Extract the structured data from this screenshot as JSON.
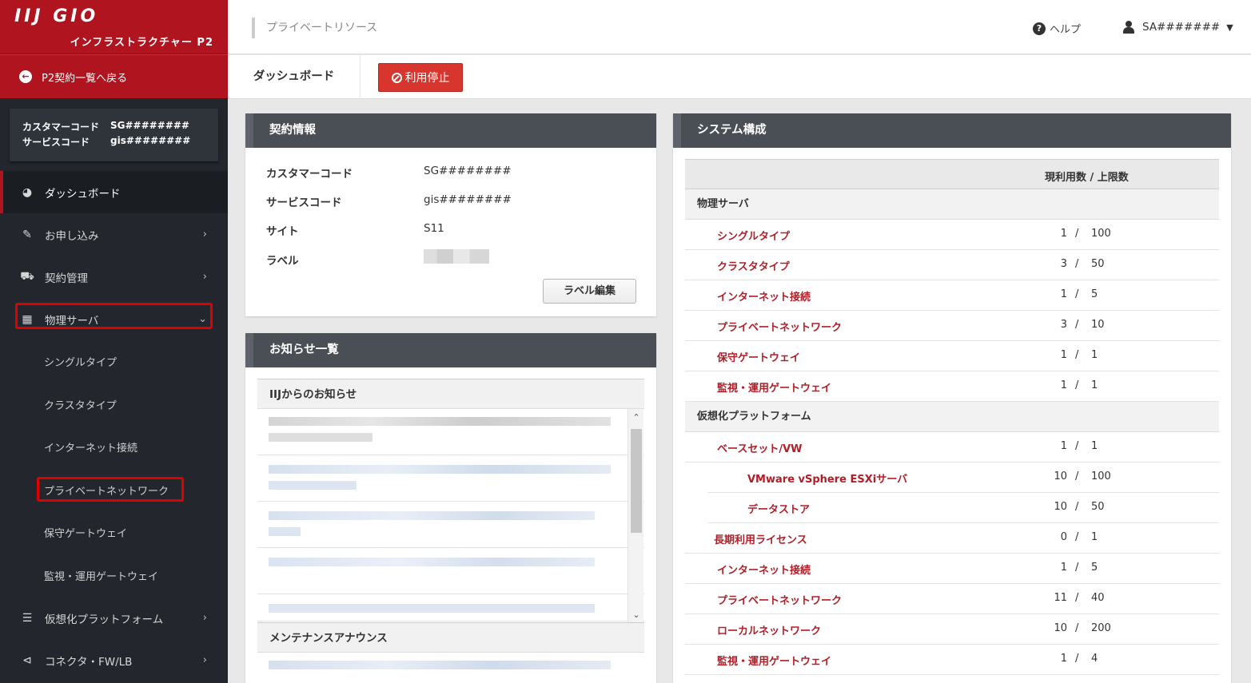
{
  "brand": {
    "logo": "IIJ GIO",
    "product": "インフラストラクチャー P2"
  },
  "sidebar": {
    "back_label": "P2契約一覧へ戻る",
    "codes": [
      {
        "key": "カスタマーコード",
        "value": "SG########"
      },
      {
        "key": "サービスコード",
        "value": "gis########"
      }
    ],
    "items": [
      {
        "label": "ダッシュボード",
        "icon": "dashboard-icon"
      },
      {
        "label": "お申し込み",
        "icon": "edit-icon"
      },
      {
        "label": "契約管理",
        "icon": "truck-icon"
      },
      {
        "label": "物理サーバ",
        "icon": "building-icon"
      },
      {
        "label": "仮想化プラットフォーム",
        "icon": "server-icon"
      },
      {
        "label": "コネクタ・FW/LB",
        "icon": "share-icon"
      }
    ],
    "sub_items": [
      "シングルタイプ",
      "クラスタタイプ",
      "インターネット接続",
      "プライベートネットワーク",
      "保守ゲートウェイ",
      "監視・運用ゲートウェイ"
    ]
  },
  "header": {
    "breadcrumb": "プライベートリソース",
    "help": "ヘルプ",
    "user": "SA#######"
  },
  "subbar": {
    "title": "ダッシュボード",
    "stop_button": "利用停止"
  },
  "contract": {
    "title": "契約情報",
    "rows": [
      {
        "key": "カスタマーコード",
        "value": "SG########"
      },
      {
        "key": "サービスコード",
        "value": "gis########"
      },
      {
        "key": "サイト",
        "value": "S11"
      },
      {
        "key": "ラベル",
        "value": ""
      }
    ],
    "edit_button": "ラベル編集"
  },
  "notices": {
    "title": "お知らせ一覧",
    "group1": "IIJからのお知らせ",
    "group2": "メンテナンスアナウンス"
  },
  "system": {
    "title": "システム構成",
    "header": "現利用数 / 上限数",
    "sections": [
      {
        "name": "物理サーバ",
        "rows": [
          {
            "name": "シングルタイプ",
            "cur": "1",
            "max": "100"
          },
          {
            "name": "クラスタタイプ",
            "cur": "3",
            "max": "50"
          },
          {
            "name": "インターネット接続",
            "cur": "1",
            "max": "5"
          },
          {
            "name": "プライベートネットワーク",
            "cur": "3",
            "max": "10"
          },
          {
            "name": "保守ゲートウェイ",
            "cur": "1",
            "max": "1"
          },
          {
            "name": "監視・運用ゲートウェイ",
            "cur": "1",
            "max": "1"
          }
        ]
      },
      {
        "name": "仮想化プラットフォーム",
        "rows": [
          {
            "name": "ベースセット/VW",
            "cur": "1",
            "max": "1"
          },
          {
            "name": "VMware vSphere ESXiサーバ",
            "cur": "10",
            "max": "100"
          },
          {
            "name": "データストア",
            "cur": "10",
            "max": "50"
          },
          {
            "name": "長期利用ライセンス",
            "cur": "0",
            "max": "1"
          },
          {
            "name": "インターネット接続",
            "cur": "1",
            "max": "5"
          },
          {
            "name": "プライベートネットワーク",
            "cur": "11",
            "max": "40"
          },
          {
            "name": "ローカルネットワーク",
            "cur": "10",
            "max": "200"
          },
          {
            "name": "監視・運用ゲートウェイ",
            "cur": "1",
            "max": "4"
          }
        ]
      }
    ],
    "separator": "/"
  }
}
